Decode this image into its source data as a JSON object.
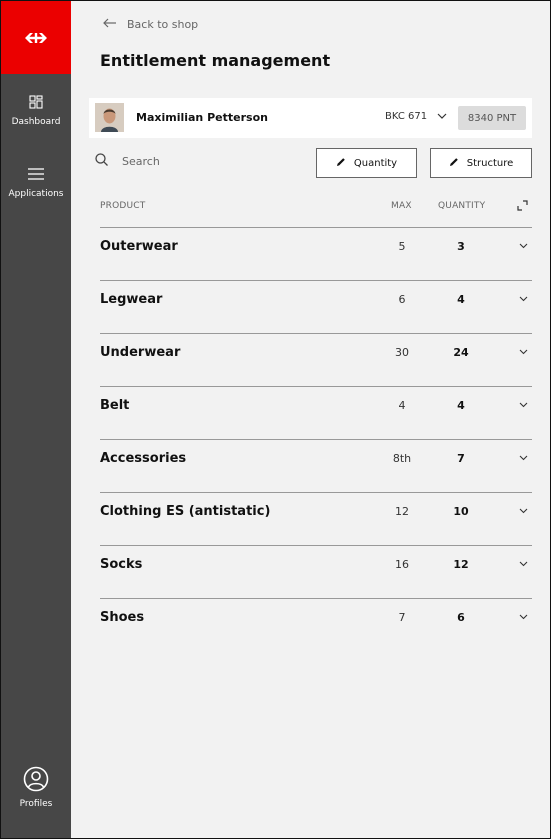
{
  "colors": {
    "brand_red": "#eb0000",
    "sidebar": "#474747"
  },
  "sidebar": {
    "logo_icon": "sbb-logo-icon",
    "items": [
      {
        "label": "Dashboard",
        "icon": "dashboard-grid-icon"
      },
      {
        "label": "Applications",
        "icon": "menu-lines-icon"
      },
      {
        "label": "Profiles",
        "icon": "user-circle-icon"
      }
    ]
  },
  "header": {
    "back_label": "Back to shop",
    "title": "Entitlement management"
  },
  "user": {
    "name": "Maximilian Petterson",
    "account": "BKC 671",
    "points": "8340 PNT"
  },
  "toolbar": {
    "search_placeholder": "Search",
    "quantity_label": "Quantity",
    "structure_label": "Structure"
  },
  "table": {
    "headers": {
      "product": "PRODUCT",
      "max": "MAX",
      "quantity": "QUANTITY"
    },
    "rows": [
      {
        "product": "Outerwear",
        "max": "5",
        "quantity": "3"
      },
      {
        "product": "Legwear",
        "max": "6",
        "quantity": "4"
      },
      {
        "product": "Underwear",
        "max": "30",
        "quantity": "24"
      },
      {
        "product": "Belt",
        "max": "4",
        "quantity": "4"
      },
      {
        "product": "Accessories",
        "max": "8th",
        "quantity": "7"
      },
      {
        "product": "Clothing ES (antistatic)",
        "max": "12",
        "quantity": "10"
      },
      {
        "product": "Socks",
        "max": "16",
        "quantity": "12"
      },
      {
        "product": "Shoes",
        "max": "7",
        "quantity": "6"
      }
    ]
  }
}
